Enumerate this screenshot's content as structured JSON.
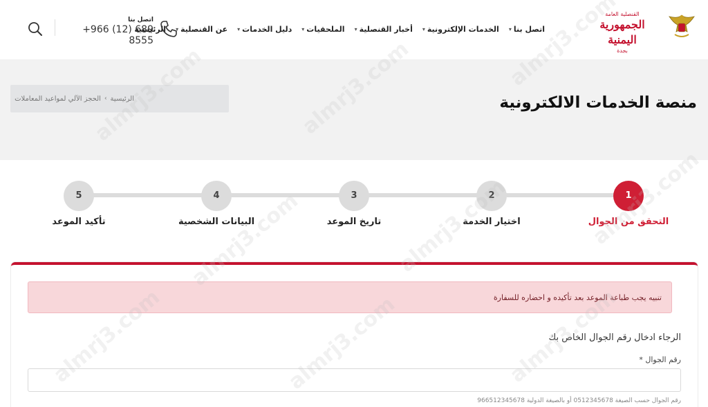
{
  "brand": {
    "line1": "القنصلية العامة",
    "line2": "الجمهورية اليمنية",
    "line3": "بجدة",
    "accent_color": "#c4122f",
    "emblem_icon": "yemen-eagle-emblem"
  },
  "nav": {
    "items": [
      {
        "label": "الرئيسية",
        "has_dropdown": false
      },
      {
        "label": "عن القنصلية",
        "has_dropdown": true
      },
      {
        "label": "دليل الخدمات",
        "has_dropdown": true
      },
      {
        "label": "الملحقيات",
        "has_dropdown": true
      },
      {
        "label": "أخبار القنصلية",
        "has_dropdown": true
      },
      {
        "label": "الخدمات الإلكترونية",
        "has_dropdown": true
      },
      {
        "label": "اتصل بنا",
        "has_dropdown": true
      }
    ],
    "chevron": "▾"
  },
  "contact": {
    "label": "اتصل بنا",
    "phone": "+966 (12) 689 8555"
  },
  "page": {
    "title": "منصة الخدمات الالكترونية",
    "breadcrumb_home": "الرئيسية",
    "breadcrumb_separator": "›",
    "breadcrumb_current": "الحجز الآلي لمواعيد المعاملات"
  },
  "stepper": {
    "steps": [
      {
        "number": "1",
        "label": "التحقق من الجوال",
        "active": true
      },
      {
        "number": "2",
        "label": "اختيار الخدمة",
        "active": false
      },
      {
        "number": "3",
        "label": "تاريخ الموعد",
        "active": false
      },
      {
        "number": "4",
        "label": "البيانات الشخصية",
        "active": false
      },
      {
        "number": "5",
        "label": "تأكيد الموعد",
        "active": false
      }
    ],
    "active_color": "#cf1f35"
  },
  "form": {
    "alert": "تنبيه يجب طباعة الموعد بعد تأكيده و احضاره للسفارة",
    "title": "الرجاء ادخال رقم الجوال الخاص بك",
    "field_label": "رقم الجوال *",
    "field_value": "",
    "hint": "رقم الجوال حسب الصيغة 0512345678 أو بالصيغة الدولية 966512345678"
  },
  "watermark": "almrj3.com"
}
